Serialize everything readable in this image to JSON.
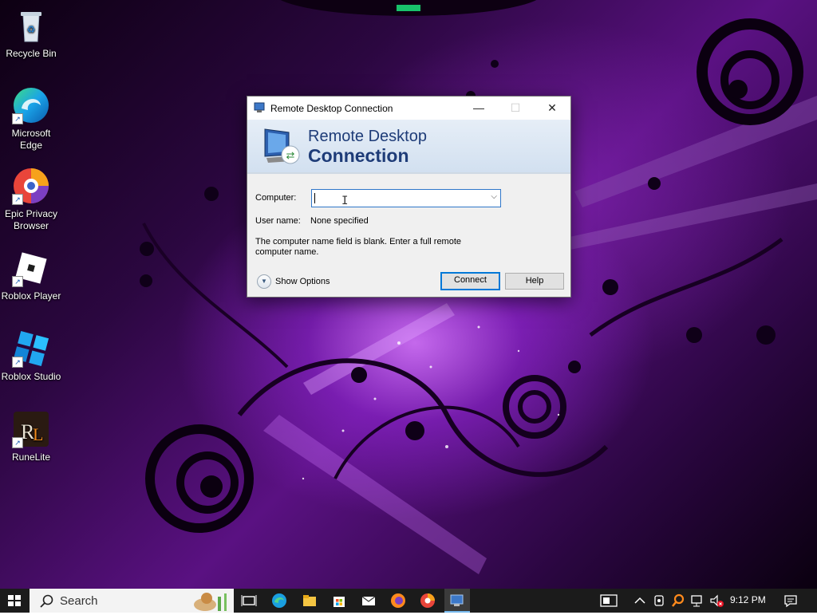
{
  "desktop": {
    "icons": [
      {
        "label": "Recycle Bin",
        "icon": "recycle-bin-icon"
      },
      {
        "label": "Microsoft Edge",
        "icon": "edge-icon"
      },
      {
        "label": "Epic Privacy Browser",
        "icon": "epic-browser-icon"
      },
      {
        "label": "Roblox Player",
        "icon": "roblox-player-icon"
      },
      {
        "label": "Roblox Studio",
        "icon": "roblox-studio-icon"
      },
      {
        "label": "RuneLite",
        "icon": "runelite-icon"
      }
    ]
  },
  "dialog": {
    "title": "Remote Desktop Connection",
    "banner_line1": "Remote Desktop",
    "banner_line2": "Connection",
    "computer_label": "Computer:",
    "computer_value": "",
    "username_label": "User name:",
    "username_value": "None specified",
    "message": "The computer name field is blank. Enter a full remote computer name.",
    "show_options": "Show Options",
    "connect": "Connect",
    "help": "Help"
  },
  "taskbar": {
    "search_placeholder": "Search",
    "clock": "9:12 PM",
    "pinned": [
      "task-view-icon",
      "edge-icon",
      "file-explorer-icon",
      "microsoft-store-icon",
      "mail-icon",
      "firefox-icon",
      "epic-browser-icon",
      "remote-desktop-icon"
    ],
    "tray": [
      "meet-now-icon",
      "chevron-up-icon",
      "network-icon",
      "search-tool-icon",
      "ethernet-icon",
      "volume-muted-icon",
      "notification-icon"
    ]
  },
  "colors": {
    "accent": "#0078d7",
    "banner_text": "#1e3c78",
    "taskbar": "#1b1b1b"
  }
}
